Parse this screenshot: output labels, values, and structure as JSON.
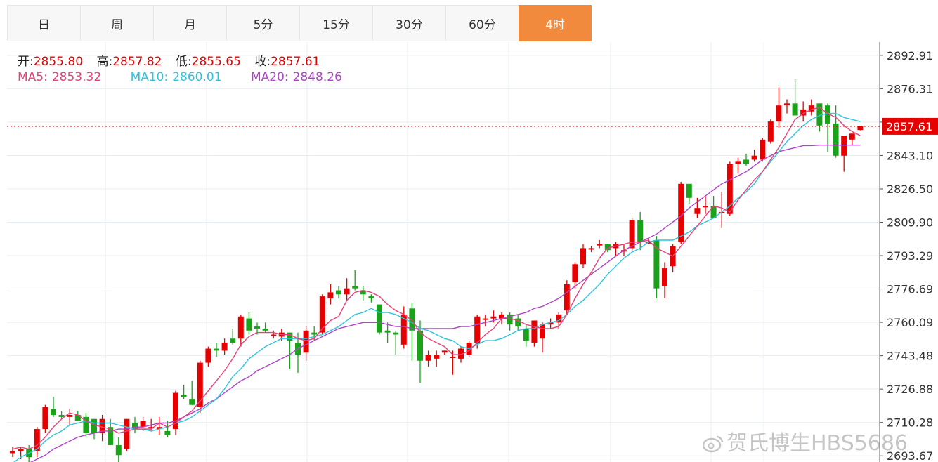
{
  "tabs": [
    {
      "label": "日"
    },
    {
      "label": "周"
    },
    {
      "label": "月"
    },
    {
      "label": "5分"
    },
    {
      "label": "15分"
    },
    {
      "label": "30分"
    },
    {
      "label": "60分"
    },
    {
      "label": "4时",
      "active": true
    }
  ],
  "ohlc": {
    "open_label": "开:",
    "open": "2855.80",
    "high_label": "高:",
    "high": "2857.82",
    "low_label": "低:",
    "low": "2855.65",
    "close_label": "收:",
    "close": "2857.61"
  },
  "ma": {
    "ma5_label": "MA5:",
    "ma5": "2853.32",
    "ma10_label": "MA10:",
    "ma10": "2860.01",
    "ma20_label": "MA20:",
    "ma20": "2848.26"
  },
  "watermark": "贺氏博生HBS5686",
  "colors": {
    "up": "#e60000",
    "down": "#1aa31a",
    "ma5": "#e8417a",
    "ma10": "#2ec4e0",
    "ma20": "#b044c8",
    "accent": "#f28a3e",
    "grid": "#e8eef3"
  },
  "chart_data": {
    "type": "candlestick",
    "y_ticks": [
      "2892.91",
      "2876.31",
      "2859.70",
      "2843.10",
      "2826.50",
      "2809.90",
      "2793.29",
      "2776.69",
      "2760.09",
      "2743.48",
      "2726.88",
      "2710.28",
      "2693.67"
    ],
    "ylim": [
      2690.6,
      2899.5
    ],
    "current_price": "2857.61",
    "ohlc": [
      [
        2695,
        2698,
        2693,
        2696
      ],
      [
        2696,
        2698,
        2692,
        2697
      ],
      [
        2697,
        2699,
        2689,
        2693
      ],
      [
        2696,
        2708,
        2693,
        2707
      ],
      [
        2707,
        2719,
        2705,
        2718
      ],
      [
        2717,
        2723,
        2713,
        2714
      ],
      [
        2714,
        2716,
        2712,
        2713
      ],
      [
        2713,
        2717,
        2709,
        2714
      ],
      [
        2714,
        2716,
        2711,
        2711
      ],
      [
        2713,
        2715,
        2703,
        2705
      ],
      [
        2712,
        2712,
        2702,
        2705
      ],
      [
        2705,
        2714,
        2701,
        2712
      ],
      [
        2708,
        2712,
        2699,
        2699
      ],
      [
        2699,
        2703,
        2690,
        2694
      ],
      [
        2697,
        2712,
        2696,
        2712
      ],
      [
        2710,
        2713,
        2705,
        2707
      ],
      [
        2708,
        2713,
        2706,
        2711
      ],
      [
        2708,
        2712,
        2706,
        2708
      ],
      [
        2707,
        2713,
        2704,
        2708
      ],
      [
        2706,
        2711,
        2703,
        2704
      ],
      [
        2707,
        2726,
        2704,
        2725
      ],
      [
        2724,
        2729,
        2722,
        2723
      ],
      [
        2722,
        2731,
        2719,
        2719
      ],
      [
        2718,
        2741,
        2715,
        2740
      ],
      [
        2740,
        2748,
        2738,
        2747
      ],
      [
        2747,
        2750,
        2743,
        2746
      ],
      [
        2746,
        2752,
        2744,
        2750
      ],
      [
        2752,
        2757,
        2749,
        2750
      ],
      [
        2752,
        2764,
        2748,
        2763
      ],
      [
        2762,
        2765,
        2754,
        2756
      ],
      [
        2758,
        2760,
        2754,
        2757
      ],
      [
        2757,
        2760,
        2755,
        2756
      ],
      [
        2754,
        2756,
        2752,
        2754
      ],
      [
        2753,
        2757,
        2751,
        2755
      ],
      [
        2755,
        2755,
        2737,
        2751
      ],
      [
        2750,
        2755,
        2735,
        2744
      ],
      [
        2745,
        2758,
        2741,
        2756
      ],
      [
        2755,
        2758,
        2751,
        2754
      ],
      [
        2755,
        2774,
        2754,
        2773
      ],
      [
        2772,
        2779,
        2769,
        2775
      ],
      [
        2776,
        2778,
        2772,
        2774
      ],
      [
        2774,
        2782,
        2771,
        2777
      ],
      [
        2778,
        2786,
        2776,
        2777
      ],
      [
        2776,
        2778,
        2771,
        2774
      ],
      [
        2773,
        2774,
        2770,
        2772
      ],
      [
        2769,
        2769,
        2754,
        2755
      ],
      [
        2756,
        2760,
        2750,
        2755
      ],
      [
        2755,
        2756,
        2744,
        2754
      ],
      [
        2749,
        2768,
        2747,
        2764
      ],
      [
        2767,
        2770,
        2741,
        2756
      ],
      [
        2756,
        2761,
        2730,
        2741
      ],
      [
        2741,
        2746,
        2738,
        2744
      ],
      [
        2742,
        2746,
        2738,
        2744
      ],
      [
        2745,
        2746,
        2744,
        2746
      ],
      [
        2743,
        2746,
        2734,
        2743
      ],
      [
        2742,
        2748,
        2740,
        2747
      ],
      [
        2744,
        2751,
        2743,
        2750
      ],
      [
        2750,
        2764,
        2747,
        2763
      ],
      [
        2762,
        2764,
        2758,
        2762
      ],
      [
        2762,
        2766,
        2760,
        2763
      ],
      [
        2762,
        2765,
        2759,
        2764
      ],
      [
        2764,
        2765,
        2756,
        2759
      ],
      [
        2762,
        2764,
        2756,
        2758
      ],
      [
        2757,
        2759,
        2748,
        2751
      ],
      [
        2750,
        2761,
        2748,
        2761
      ],
      [
        2752,
        2760,
        2745,
        2759
      ],
      [
        2759,
        2762,
        2757,
        2760
      ],
      [
        2760,
        2765,
        2757,
        2764
      ],
      [
        2766,
        2781,
        2764,
        2779
      ],
      [
        2780,
        2790,
        2777,
        2789
      ],
      [
        2789,
        2799,
        2787,
        2797
      ],
      [
        2797,
        2798,
        2795,
        2797
      ],
      [
        2799,
        2801,
        2797,
        2799
      ],
      [
        2799,
        2799,
        2795,
        2796
      ],
      [
        2797,
        2800,
        2793,
        2799
      ],
      [
        2796,
        2799,
        2793,
        2796
      ],
      [
        2797,
        2812,
        2795,
        2811
      ],
      [
        2811,
        2815,
        2796,
        2800
      ],
      [
        2800,
        2802,
        2799,
        2800
      ],
      [
        2801,
        2803,
        2772,
        2777
      ],
      [
        2778,
        2790,
        2772,
        2787
      ],
      [
        2788,
        2799,
        2785,
        2798
      ],
      [
        2800,
        2830,
        2799,
        2829
      ],
      [
        2829,
        2829,
        2819,
        2822
      ],
      [
        2814,
        2822,
        2812,
        2817
      ],
      [
        2818,
        2823,
        2814,
        2818
      ],
      [
        2818,
        2823,
        2812,
        2812
      ],
      [
        2815,
        2825,
        2807,
        2815
      ],
      [
        2814,
        2840,
        2813,
        2839
      ],
      [
        2839,
        2842,
        2834,
        2840
      ],
      [
        2841,
        2844,
        2838,
        2839
      ],
      [
        2841,
        2846,
        2840,
        2843
      ],
      [
        2841,
        2852,
        2840,
        2851
      ],
      [
        2850,
        2861,
        2849,
        2860
      ],
      [
        2860,
        2877,
        2857,
        2868
      ],
      [
        2868,
        2871,
        2864,
        2869
      ],
      [
        2869,
        2881,
        2863,
        2863
      ],
      [
        2863,
        2870,
        2860,
        2866
      ],
      [
        2865,
        2871,
        2863,
        2868
      ],
      [
        2869,
        2868,
        2855,
        2858
      ],
      [
        2868,
        2869,
        2845,
        2859
      ],
      [
        2859,
        2868,
        2842,
        2843
      ],
      [
        2843,
        2853,
        2835,
        2853
      ],
      [
        2851,
        2854,
        2848,
        2854
      ],
      [
        2855.8,
        2857.82,
        2855.65,
        2857.61
      ]
    ],
    "ma5": [
      2697,
      2698,
      2697,
      2699,
      2703,
      2708,
      2712,
      2715,
      2714,
      2711,
      2709,
      2708,
      2707,
      2705,
      2706,
      2707,
      2707,
      2707,
      2710,
      2708,
      2710,
      2713,
      2716,
      2721,
      2726,
      2731,
      2736,
      2742,
      2749,
      2753,
      2755,
      2755,
      2755,
      2754,
      2754,
      2752,
      2751,
      2752,
      2757,
      2761,
      2763,
      2771,
      2775,
      2776,
      2775,
      2773,
      2769,
      2766,
      2764,
      2761,
      2755,
      2752,
      2750,
      2748,
      2744,
      2744,
      2746,
      2750,
      2754,
      2757,
      2762,
      2762,
      2761,
      2759,
      2758,
      2757,
      2757,
      2758,
      2764,
      2772,
      2779,
      2785,
      2792,
      2797,
      2798,
      2799,
      2800,
      2800,
      2801,
      2797,
      2795,
      2793,
      2798,
      2803,
      2808,
      2813,
      2818,
      2817,
      2815,
      2821,
      2826,
      2831,
      2835,
      2841,
      2847,
      2854,
      2861,
      2864,
      2866,
      2867,
      2864,
      2862,
      2858,
      2855,
      2853
    ],
    "ma10": [
      2690,
      2693,
      2695,
      2697,
      2701,
      2704,
      2706,
      2709,
      2710,
      2711,
      2710,
      2710,
      2710,
      2709,
      2708,
      2707,
      2707,
      2706,
      2707,
      2708,
      2710,
      2711,
      2713,
      2716,
      2719,
      2722,
      2727,
      2733,
      2737,
      2742,
      2745,
      2748,
      2750,
      2752,
      2752,
      2752,
      2752,
      2753,
      2754,
      2756,
      2758,
      2761,
      2764,
      2765,
      2767,
      2765,
      2765,
      2764,
      2762,
      2760,
      2757,
      2756,
      2754,
      2752,
      2751,
      2748,
      2747,
      2749,
      2751,
      2751,
      2752,
      2754,
      2756,
      2757,
      2757,
      2759,
      2760,
      2761,
      2764,
      2768,
      2771,
      2775,
      2779,
      2784,
      2788,
      2792,
      2795,
      2797,
      2800,
      2801,
      2801,
      2801,
      2803,
      2805,
      2808,
      2810,
      2812,
      2815,
      2818,
      2822,
      2825,
      2829,
      2835,
      2840,
      2845,
      2850,
      2854,
      2858,
      2861,
      2863,
      2864,
      2864,
      2862,
      2861,
      2860
    ],
    "ma20": [
      2686,
      2688,
      2690,
      2692,
      2694,
      2697,
      2699,
      2701,
      2703,
      2704,
      2705,
      2706,
      2706,
      2707,
      2707,
      2708,
      2708,
      2709,
      2710,
      2710,
      2711,
      2713,
      2715,
      2717,
      2720,
      2722,
      2725,
      2728,
      2731,
      2733,
      2736,
      2738,
      2740,
      2742,
      2744,
      2747,
      2749,
      2751,
      2753,
      2755,
      2757,
      2758,
      2759,
      2760,
      2760,
      2760,
      2759,
      2758,
      2758,
      2757,
      2757,
      2757,
      2757,
      2757,
      2757,
      2758,
      2758,
      2759,
      2760,
      2761,
      2762,
      2763,
      2764,
      2765,
      2767,
      2768,
      2770,
      2772,
      2775,
      2778,
      2781,
      2784,
      2787,
      2790,
      2793,
      2796,
      2798,
      2800,
      2802,
      2804,
      2807,
      2810,
      2813,
      2817,
      2820,
      2823,
      2826,
      2829,
      2831,
      2833,
      2835,
      2838,
      2841,
      2843,
      2845,
      2846,
      2847,
      2848,
      2848,
      2848.26,
      2848.26,
      2848.26,
      2848.26,
      2848.26,
      2848.26
    ]
  }
}
